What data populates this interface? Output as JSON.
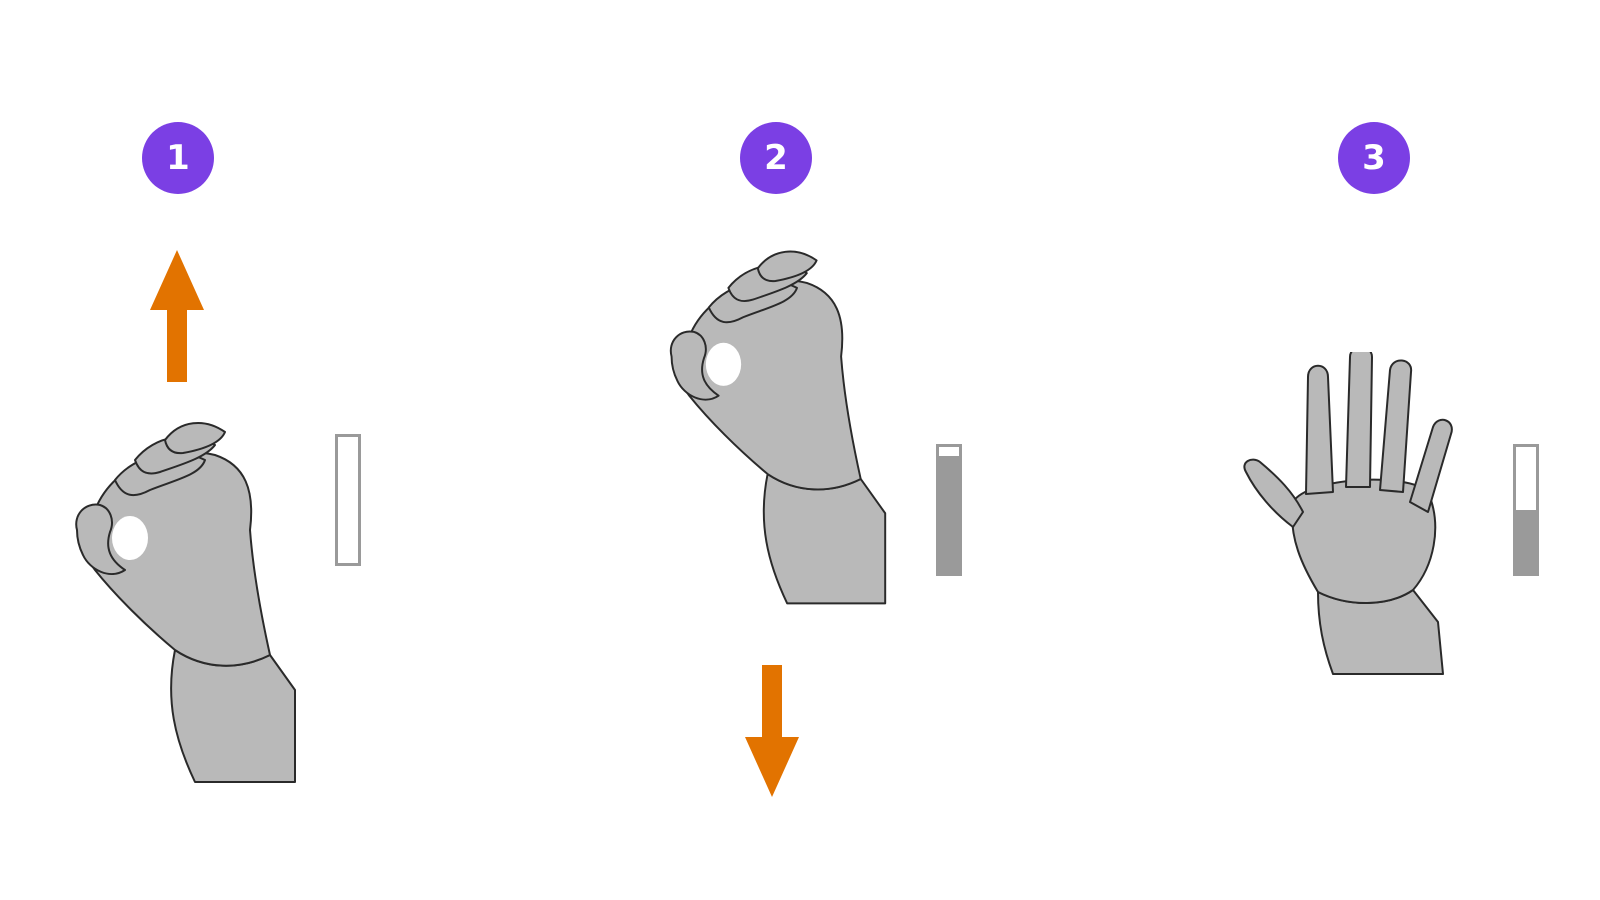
{
  "colors": {
    "badge": "#7b3fe4",
    "arrow": "#e27300",
    "meter": "#9a9a9a",
    "hand_fill": "#b9b9b9",
    "hand_stroke": "#2a2a2a"
  },
  "steps": [
    {
      "number": "1",
      "arrow": "up-arrow-icon",
      "hand": "pinch-hand-icon",
      "meter_level": 0.0
    },
    {
      "number": "2",
      "arrow": "down-arrow-icon",
      "hand": "pinch-hand-icon",
      "meter_level": 0.93
    },
    {
      "number": "3",
      "arrow": null,
      "hand": "open-hand-icon",
      "meter_level": 0.5
    }
  ]
}
